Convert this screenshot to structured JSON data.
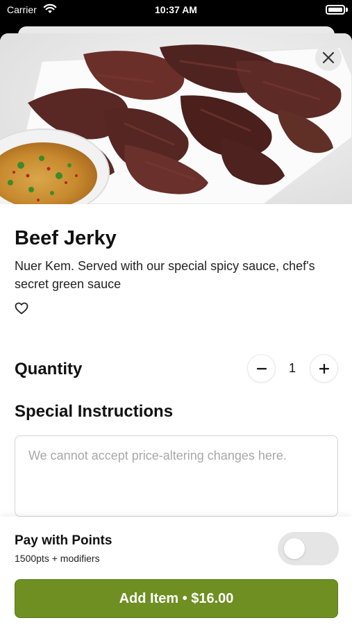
{
  "status_bar": {
    "carrier": "Carrier",
    "time": "10:37 AM"
  },
  "item": {
    "name": "Beef Jerky",
    "description": "Nuer Kem. Served with our special spicy sauce, chef's secret green sauce",
    "favorited": false
  },
  "quantity": {
    "label": "Quantity",
    "value": "1",
    "decrement_icon": "minus-icon",
    "increment_icon": "plus-icon"
  },
  "special_instructions": {
    "label": "Special Instructions",
    "placeholder": "We cannot accept price-altering changes here.",
    "value": ""
  },
  "points": {
    "title": "Pay with Points",
    "subtitle": "1500pts + modifiers",
    "enabled": false
  },
  "add_button": {
    "label": "Add Item • $16.00"
  },
  "colors": {
    "accent": "#6f8f22",
    "toggle_off": "#e5e5e5"
  }
}
